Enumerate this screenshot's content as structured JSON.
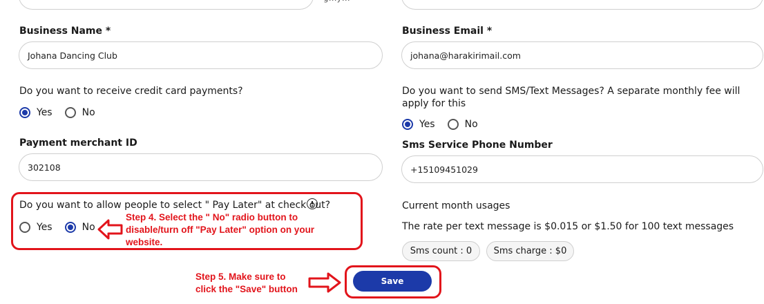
{
  "form": {
    "business_name": {
      "label": "Business Name *",
      "value": "Johana Dancing Club"
    },
    "business_email": {
      "label": "Business Email *",
      "value": "johana@harakirimail.com"
    },
    "credit_card": {
      "question": "Do you want to receive credit card payments?",
      "options": [
        "Yes",
        "No"
      ],
      "selected": "Yes"
    },
    "sms": {
      "question": "Do you want to send SMS/Text Messages? A separate monthly fee will apply for this",
      "options": [
        "Yes",
        "No"
      ],
      "selected": "Yes"
    },
    "merchant_id": {
      "label": "Payment merchant ID",
      "value": "302108"
    },
    "sms_phone": {
      "label": "Sms Service Phone Number",
      "value": "+15109451029"
    },
    "pay_later": {
      "question": "Do you want to allow people to select \" Pay Later\" at check out?",
      "options": [
        "Yes",
        "No"
      ],
      "selected": "No"
    },
    "usage": {
      "title": "Current month usages",
      "rate_text": "The rate per text message is $0.015 or $1.50 for 100 text messages",
      "sms_count": "Sms count : 0",
      "sms_charge": "Sms charge : $0"
    },
    "save_label": "Save"
  },
  "annotations": {
    "step4_line1": "Step 4. Select the \" No\" radio button to",
    "step4_line2": "disable/turn off \"Pay Later\" option on your",
    "step4_line3": "website.",
    "step5_line1": "Step 5. Make sure to",
    "step5_line2": "click the \"Save\" button",
    "color": "#e2141b"
  },
  "theme": {
    "accent": "#1c3aa9"
  },
  "icons": {
    "info": "info-circle-icon",
    "arrow": "arrow-left-icon"
  }
}
